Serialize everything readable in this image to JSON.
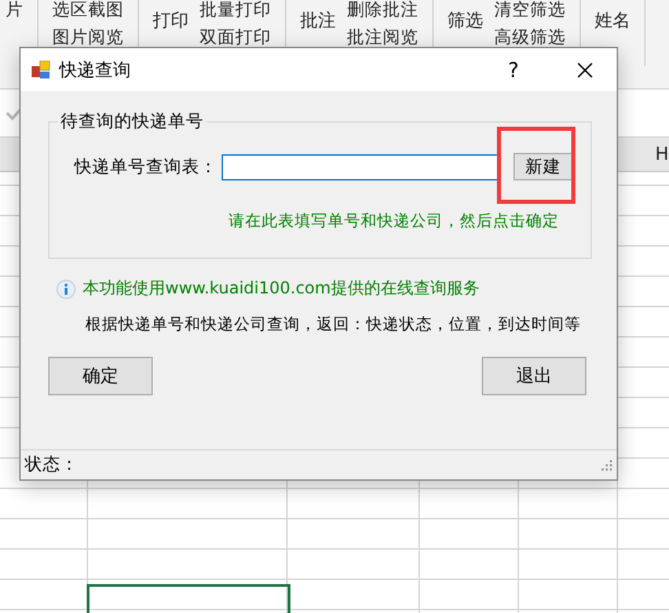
{
  "ribbon": {
    "groups": [
      {
        "items": [
          "片"
        ]
      },
      {
        "items": [
          "选区截图",
          "图片阅览"
        ]
      },
      {
        "big": "打印",
        "items": [
          "批量打印",
          "双面打印"
        ]
      },
      {
        "big": "批注",
        "items": [
          "删除批注",
          "批注阅览"
        ]
      },
      {
        "big": "筛选",
        "items": [
          "清空筛选",
          "高级筛选"
        ]
      },
      {
        "big": "姓名"
      }
    ]
  },
  "sheet": {
    "column_header": "H"
  },
  "dialog": {
    "title": "快递查询",
    "help": "?",
    "group_title": "待查询的快递单号",
    "field_label": "快递单号查询表：",
    "new_button": "新建",
    "hint": "请在此表填写单号和快递公司，然后点击确定",
    "info": "本功能使用www.kuaidi100.com提供的在线查询服务",
    "description": "根据快递单号和快递公司查询，返回：快递状态，位置，到达时间等",
    "buttons": [
      {
        "label": "确定"
      },
      {
        "label": "退出"
      }
    ],
    "status_label": "状态："
  }
}
